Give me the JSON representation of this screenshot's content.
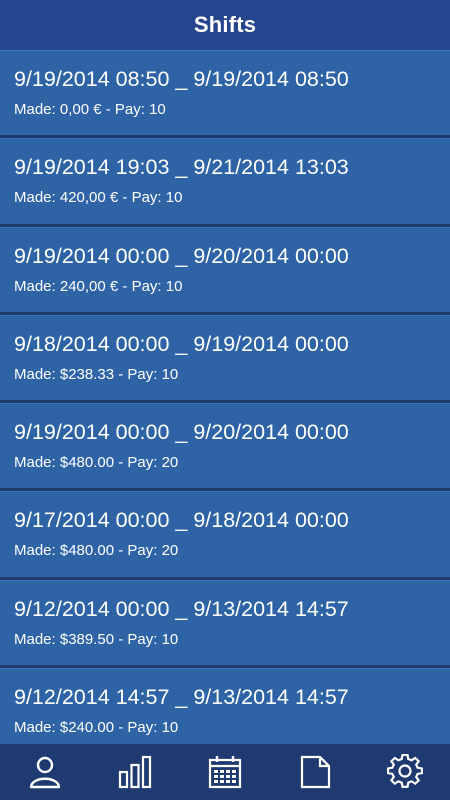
{
  "header": {
    "title": "Shifts"
  },
  "shifts": [
    {
      "range": "9/19/2014 08:50 _ 9/19/2014 08:50",
      "detail": "Made: 0,00 € - Pay: 10"
    },
    {
      "range": "9/19/2014 19:03 _ 9/21/2014 13:03",
      "detail": "Made: 420,00 € - Pay: 10"
    },
    {
      "range": "9/19/2014 00:00 _ 9/20/2014 00:00",
      "detail": "Made: 240,00 € - Pay: 10"
    },
    {
      "range": "9/18/2014 00:00 _ 9/19/2014 00:00",
      "detail": "Made: $238.33 - Pay: 10"
    },
    {
      "range": "9/19/2014 00:00 _ 9/20/2014 00:00",
      "detail": "Made: $480.00 - Pay: 20"
    },
    {
      "range": "9/17/2014 00:00 _ 9/18/2014 00:00",
      "detail": "Made: $480.00 - Pay: 20"
    },
    {
      "range": "9/12/2014 00:00 _ 9/13/2014 14:57",
      "detail": "Made: $389.50 - Pay: 10"
    },
    {
      "range": "9/12/2014 14:57 _ 9/13/2014 14:57",
      "detail": "Made: $240.00 - Pay: 10"
    }
  ],
  "tabbar": {
    "tabs": [
      {
        "icon": "person-icon"
      },
      {
        "icon": "bar-chart-icon"
      },
      {
        "icon": "calendar-icon"
      },
      {
        "icon": "document-icon"
      },
      {
        "icon": "gear-icon"
      }
    ]
  },
  "colors": {
    "header_bg": "#26458f",
    "row_bg": "#2e63a6",
    "tabbar_bg": "#1f3a70",
    "text": "#ffffff"
  }
}
